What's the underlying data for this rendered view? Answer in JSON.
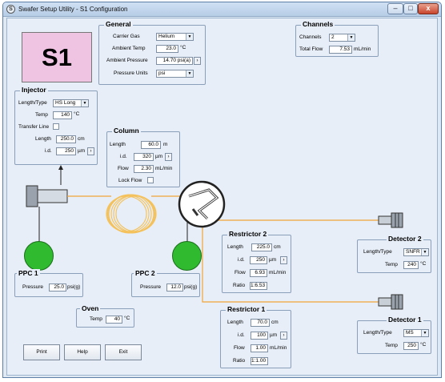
{
  "window": {
    "title": "Swafer Setup Utility - S1 Configuration",
    "icon": "app-icon"
  },
  "titlebar_buttons": {
    "minimize": "–",
    "maximize": "□",
    "close": "x"
  },
  "badge": "S1",
  "general": {
    "title": "General",
    "carrier_gas_label": "Carrier Gas",
    "carrier_gas_value": "Helium",
    "ambient_temp_label": "Ambient Temp",
    "ambient_temp_value": "23.0",
    "ambient_temp_unit": "°C",
    "ambient_pressure_label": "Ambient Pressure",
    "ambient_pressure_value": "14.70 psi(a)",
    "pressure_units_label": "Pressure Units",
    "pressure_units_value": "psi"
  },
  "channels": {
    "title": "Channels",
    "channels_label": "Channels",
    "channels_value": "2",
    "total_flow_label": "Total Flow",
    "total_flow_value": "7.53",
    "total_flow_unit": "mL/min"
  },
  "injector": {
    "title": "Injector",
    "length_type_label": "Length/Type",
    "length_type_value": "HS Long",
    "temp_label": "Temp",
    "temp_value": "140",
    "temp_unit": "°C",
    "transfer_line_label": "Transfer Line",
    "length_label": "Length",
    "length_value": "250.0",
    "length_unit": "cm",
    "id_label": "i.d.",
    "id_value": "250",
    "id_unit": "µm"
  },
  "column": {
    "title": "Column",
    "length_label": "Length",
    "length_value": "60.0",
    "length_unit": "m",
    "id_label": "i.d.",
    "id_value": "320",
    "id_unit": "µm",
    "flow_label": "Flow",
    "flow_value": "2.30",
    "flow_unit": "mL/min",
    "lock_flow_label": "Lock Flow"
  },
  "ppc1": {
    "title": "PPC 1",
    "pressure_label": "Pressure",
    "pressure_value": "25.0",
    "pressure_unit": "psi(g)"
  },
  "ppc2": {
    "title": "PPC 2",
    "pressure_label": "Pressure",
    "pressure_value": "12.0",
    "pressure_unit": "psi(g)"
  },
  "oven": {
    "title": "Oven",
    "temp_label": "Temp",
    "temp_value": "40",
    "temp_unit": "°C"
  },
  "restrictor2": {
    "title": "Restrictor 2",
    "length_label": "Length",
    "length_value": "225.0",
    "length_unit": "cm",
    "id_label": "i.d.",
    "id_value": "250",
    "id_unit": "µm",
    "flow_label": "Flow",
    "flow_value": "6.93",
    "flow_unit": "mL/min",
    "ratio_label": "Ratio",
    "ratio_value": "1:6.53"
  },
  "restrictor1": {
    "title": "Restrictor 1",
    "length_label": "Length",
    "length_value": "70.0",
    "length_unit": "cm",
    "id_label": "i.d.",
    "id_value": "100",
    "id_unit": "µm",
    "flow_label": "Flow",
    "flow_value": "1.00",
    "flow_unit": "mL/min",
    "ratio_label": "Ratio",
    "ratio_value": "1:1.00"
  },
  "detector2": {
    "title": "Detector 2",
    "length_type_label": "Length/Type",
    "length_type_value": "SNFR",
    "temp_label": "Temp",
    "temp_value": "240",
    "temp_unit": "°C"
  },
  "detector1": {
    "title": "Detector 1",
    "length_type_label": "Length/Type",
    "length_type_value": "MS",
    "temp_label": "Temp",
    "temp_value": "250",
    "temp_unit": "°C"
  },
  "buttons": {
    "print": "Print",
    "help": "Help",
    "exit": "Exit"
  },
  "colors": {
    "badge_bg": "#efc3e2",
    "ppc_green": "#2fba2f",
    "flow_line": "#f2a43a",
    "coil": "#f4c15a"
  }
}
